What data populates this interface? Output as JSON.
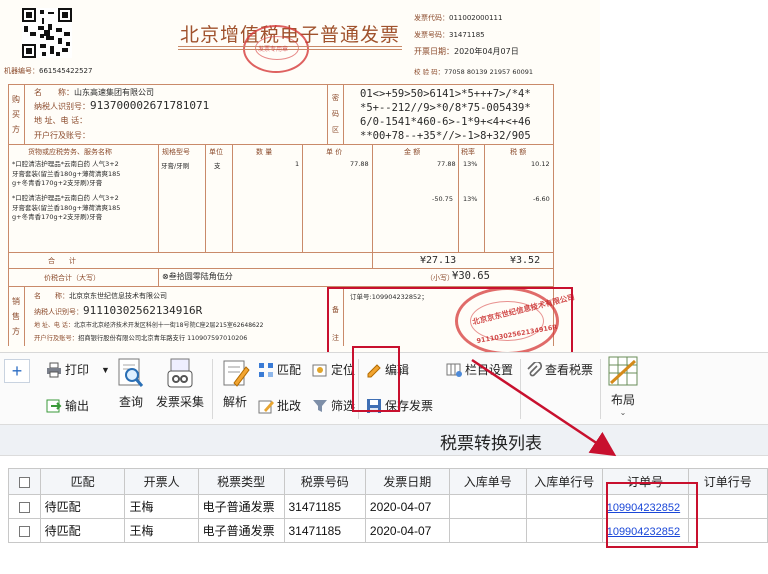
{
  "invoice": {
    "title": "北京增值税电子普通发票",
    "machine_no_label": "机器编号：",
    "machine_no": "661545422527",
    "code_label": "发票代码：",
    "code": "011002000111",
    "number_label": "发票号码：",
    "number": "31471185",
    "date_label": "开票日期：",
    "date": "2020年04月07日",
    "check_label": "校 验 码：",
    "check_code": "77058 80139 21957 60091",
    "buyer_side_label": [
      "购",
      "买",
      "方"
    ],
    "seller_side_label": [
      "销",
      "售",
      "方"
    ],
    "buyer": {
      "name_label": "名　　称：",
      "name": "山东高速集团有限公司",
      "tax_label": "纳税人识别号：",
      "tax_id": "913700002671781071",
      "addr_label": "地 址、电 话：",
      "bank_label": "开户行及账号："
    },
    "cipher_side_label": [
      "密",
      "码",
      "区"
    ],
    "cipher": [
      "01<>+59>50>6141>*5+++7>/*4*",
      "*5+--212//9>*0/8*75-005439*",
      "6/0-1541*460-6>-1*9+<4+<+46",
      "**00+78--+35*//>-1>8+32/905"
    ],
    "columns": [
      "货物或应税劳务、服务名称",
      "规格型号",
      "单位",
      "数 量",
      "单 价",
      "金 额",
      "税率",
      "税 额"
    ],
    "item1_desc": [
      "*口腔清洁护理品*云南白药 人气3+2",
      "牙膏套装(留兰香180g+薄荷清爽185",
      "g+冬青香170g+2支牙刷)牙膏"
    ],
    "item1_spec": "牙膏/牙刷",
    "item1_unit": "支",
    "item1_qty": "1",
    "item1_price": "77.88",
    "item1_amount": "77.88",
    "item1_rate": "13%",
    "item1_tax": "10.12",
    "item2_desc": [
      "*口腔清洁护理品*云南白药 人气3+2",
      "牙膏套装(留兰香180g+薄荷清爽185",
      "g+冬青香170g+2支牙刷)牙膏"
    ],
    "item2_amount": "-50.75",
    "item2_rate": "13%",
    "item2_tax": "-6.60",
    "total_label": "合　　计",
    "total_amount": "¥27.13",
    "total_tax": "¥3.52",
    "grand_label": "价税合计（大写）",
    "grand_upper": "⊗叁拾圆零陆角伍分",
    "grand_small_label": "（小写）",
    "grand_small": "¥30.65",
    "seller": {
      "name_label": "名　　称：",
      "name": "北京京东世纪信息技术有限公司",
      "tax_label": "纳税人识别号：",
      "tax_id": "91110302562134916R",
      "addr_label": "地 址、电 话：",
      "addr": "北京市北京经济技术开发区科创十一街18号院C座2层215室62648622",
      "bank_label": "开户行及账号：",
      "bank": "招商银行股份有限公司北京青年路支行 110907597010206"
    },
    "remark_side_label": [
      "备",
      "注"
    ],
    "remark": "订单号:109904232852；",
    "stamp_text": "北京京东世纪信息技术有限公司",
    "stamp_number": "91110302562134916R",
    "stamp_small": "发票专用章"
  },
  "toolbar": {
    "print_label": "打印",
    "export_label": "输出",
    "query_label": "查询",
    "collect_label": "发票采集",
    "parse_label": "解析",
    "match_label": "匹配",
    "locate_label": "定位",
    "edit_label": "编辑",
    "column_label": "栏目设置",
    "view_label": "查看税票",
    "batch_label": "批改",
    "filter_label": "筛选",
    "save_label": "保存发票",
    "layout_label": "布局"
  },
  "list_title": "税票转换列表",
  "grid": {
    "headers": [
      "匹配",
      "开票人",
      "税票类型",
      "税票号码",
      "发票日期",
      "入库单号",
      "入库单行号",
      "订单号",
      "订单行号"
    ],
    "rows": [
      [
        "待匹配",
        "王梅",
        "电子普通发票",
        "31471185",
        "2020-04-07",
        "",
        "",
        "109904232852",
        ""
      ],
      [
        "待匹配",
        "王梅",
        "电子普通发票",
        "31471185",
        "2020-04-07",
        "",
        "",
        "109904232852",
        ""
      ]
    ]
  },
  "colors": {
    "highlight": "#c8102e",
    "invoice_brown": "#8b4a2b",
    "link": "#1a47d8",
    "stamp_red": "#d63a3a"
  }
}
